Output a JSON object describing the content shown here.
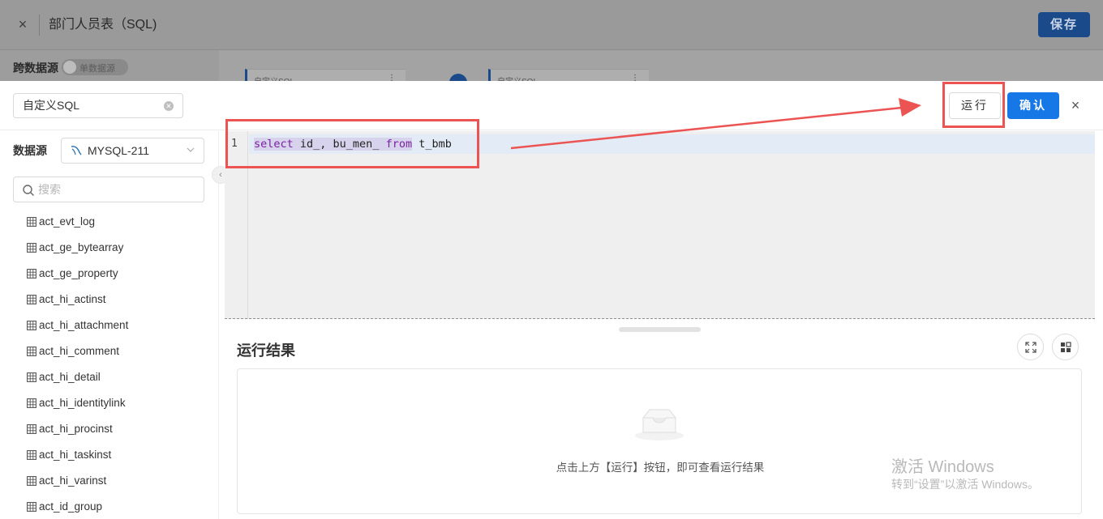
{
  "background": {
    "title": "部门人员表（SQL)",
    "close_glyph": "×",
    "save_label": "保存",
    "cross_source_label": "跨数据源",
    "cross_source_toggle": "单数据源",
    "nodes": [
      {
        "label": "自定义SQL",
        "menu": "⋮"
      },
      {
        "label": "自定义SQL",
        "menu": "⋮"
      }
    ]
  },
  "modal": {
    "sql_name": "自定义SQL",
    "run_label": "运行",
    "confirm_label": "确认",
    "close_glyph": "×"
  },
  "sidebar": {
    "datasource_label": "数据源",
    "datasource_value": "MYSQL-211",
    "search_placeholder": "搜索",
    "tables": [
      "act_evt_log",
      "act_ge_bytearray",
      "act_ge_property",
      "act_hi_actinst",
      "act_hi_attachment",
      "act_hi_comment",
      "act_hi_detail",
      "act_hi_identitylink",
      "act_hi_procinst",
      "act_hi_taskinst",
      "act_hi_varinst",
      "act_id_group"
    ],
    "collapse_glyph": "‹"
  },
  "editor": {
    "line_number": "1",
    "tokens": {
      "select": "select",
      "cols": " id_, bu_men_ ",
      "from": "from",
      "table": " t_bmb"
    }
  },
  "results": {
    "title": "运行结果",
    "empty_text": "点击上方【运行】按钮，即可查看运行结果"
  },
  "watermark": {
    "title": "激活 Windows",
    "subtitle": "转到“设置”以激活 Windows。"
  },
  "colors": {
    "primary": "#1677e6",
    "annotation": "#ec5353",
    "keyword": "#7a1f9e"
  }
}
